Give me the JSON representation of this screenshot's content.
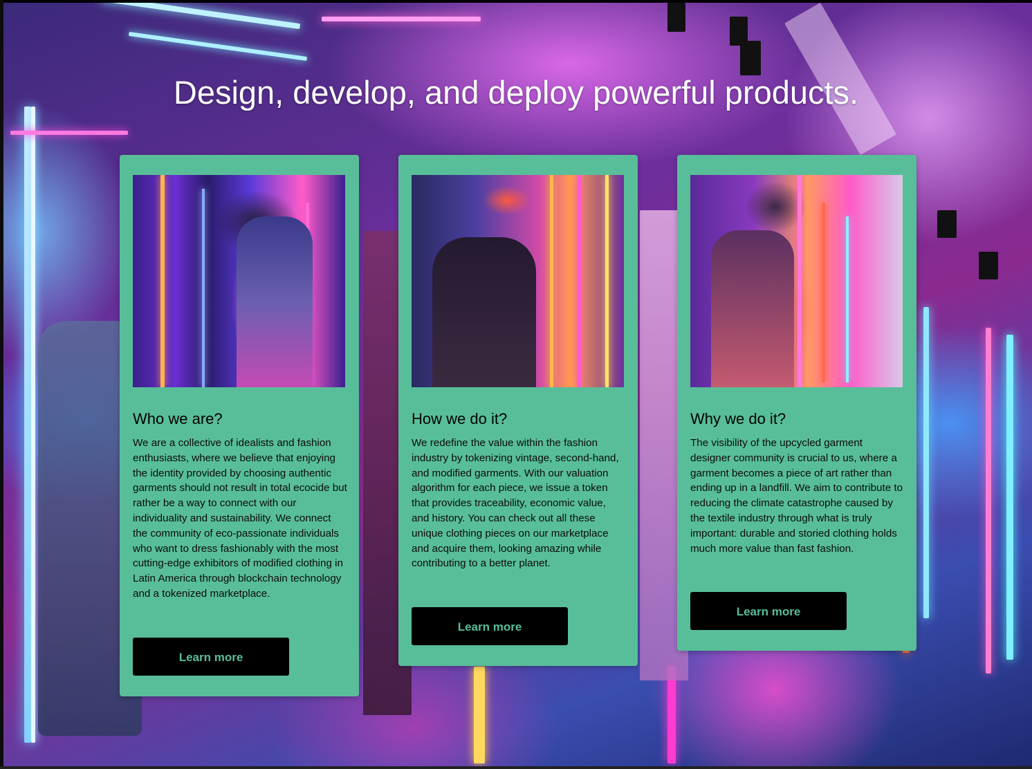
{
  "hero": {
    "headline": "Design, develop, and deploy powerful products."
  },
  "colors": {
    "card_bg": "#58be99",
    "button_bg": "#000000",
    "button_text": "#58be99",
    "headline": "#ffffff"
  },
  "cards": [
    {
      "image": "neon-fashion-portrait-1",
      "title": "Who we are?",
      "text": "We are a collective of idealists and fashion enthusiasts, where we believe that enjoying the identity provided by choosing authentic garments should not result in total ecocide but rather be a way to connect with our individuality and sustainability. We connect the community of eco-passionate individuals who want to dress fashionably with the most cutting-edge exhibitors of modified clothing in Latin America through blockchain technology and a tokenized marketplace.",
      "button_label": "Learn more"
    },
    {
      "image": "neon-fashion-portrait-2",
      "title": "How we do it?",
      "text": "We redefine the value within the fashion industry by tokenizing vintage, second-hand, and modified garments. With our valuation algorithm for each piece, we issue a token that provides traceability, economic value, and history. You can check out all these unique clothing pieces on our marketplace and acquire them, looking amazing while contributing to a better planet.",
      "button_label": "Learn more"
    },
    {
      "image": "neon-fashion-portrait-3",
      "title": "Why we do it?",
      "text": "The visibility of the upcycled garment designer community is crucial to us, where a garment becomes a piece of art rather than ending up in a landfill. We aim to contribute to reducing the climate catastrophe caused by the textile industry through what is truly important: durable and storied clothing holds much more value than fast fashion.",
      "button_label": "Learn more"
    }
  ]
}
